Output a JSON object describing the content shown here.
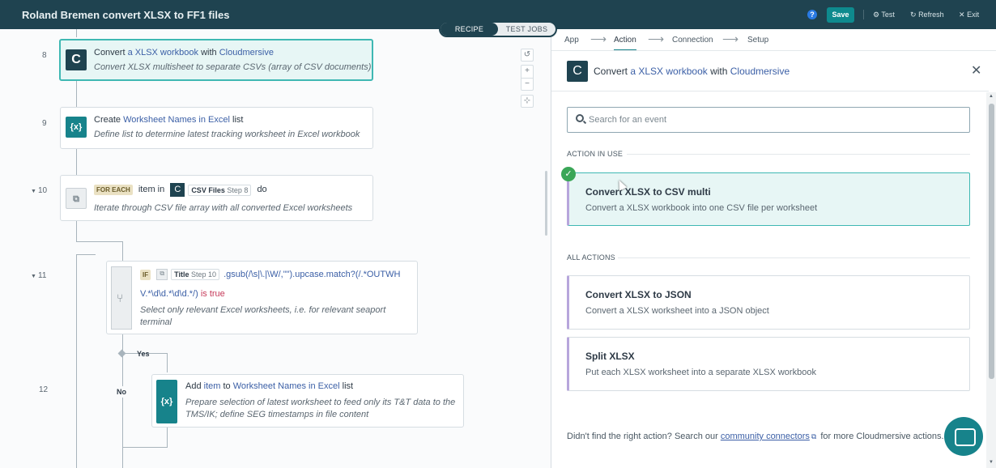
{
  "topbar": {
    "title": "Roland Bremen convert XLSX to FF1 files",
    "tabs": [
      "RECIPE",
      "TEST JOBS"
    ],
    "help": "?",
    "save": "Save",
    "test": "Test",
    "refresh": "Refresh",
    "exit": "Exit"
  },
  "canvas": {
    "steps": [
      {
        "no": "8",
        "l1_pre": "Convert ",
        "l1_a": "a XLSX workbook",
        "l1_mid": " with ",
        "l1_b": "Cloudmersive",
        "l2": "Convert XLSX multisheet to separate CSVs (array of CSV documents)"
      },
      {
        "no": "9",
        "l1_pre": "Create ",
        "l1_a": "Worksheet Names in Excel",
        "l1_post": " list",
        "l2": "Define list to determine latest tracking worksheet in Excel workbook"
      },
      {
        "no": "10",
        "pill": "FOR EACH",
        "item": "item in",
        "dp_name": "CSV Files",
        "dp_step": "Step 8",
        "do": "do",
        "l2": "Iterate through CSV file array with all converted Excel worksheets"
      },
      {
        "no": "11",
        "pill": "IF",
        "dp_name": "Title",
        "dp_step": "Step 10",
        "code1": ".gsub(/\\s|\\.|\\W/,\"\").upcase.match?(/.*OUTWH",
        "code2": "V.*\\d\\d.*\\d\\d.*/)",
        "istrue": "is true",
        "l2": "Select only relevant Excel worksheets, i.e. for relevant seaport terminal"
      },
      {
        "no": "12",
        "l1_pre": "Add ",
        "l1_a": "item",
        "l1_mid": " to ",
        "l1_b": "Worksheet Names in Excel",
        "l1_post": " list",
        "l2": "Prepare selection of latest worksheet to feed only its T&T data to the TMS/IK; define SEG timestamps in file content"
      }
    ],
    "yes": "Yes",
    "no": "No"
  },
  "panel": {
    "wizard": [
      "App",
      "Action",
      "Connection",
      "Setup"
    ],
    "header_pre": "Convert ",
    "header_a": "a XLSX workbook",
    "header_mid": " with ",
    "header_b": "Cloudmersive",
    "search_placeholder": "Search for an event",
    "in_use_label": "ACTION IN USE",
    "in_use": {
      "name": "Convert XLSX to CSV multi",
      "desc": "Convert a XLSX workbook into one CSV file per worksheet"
    },
    "all_label": "ALL ACTIONS",
    "actions": [
      {
        "name": "Convert XLSX to JSON",
        "desc": "Convert a XLSX worksheet into a JSON object"
      },
      {
        "name": "Split XLSX",
        "desc": "Put each XLSX worksheet into a separate XLSX workbook"
      }
    ],
    "footer_pre": "Didn't find the right action? Search our ",
    "footer_link": "community connectors",
    "footer_post": " for more Cloudmersive actions."
  },
  "colors": {
    "topbar": "#1f4350",
    "accent": "#17838b",
    "selected_border": "#3fb8b3",
    "action_stripe": "#b7a6dc"
  }
}
